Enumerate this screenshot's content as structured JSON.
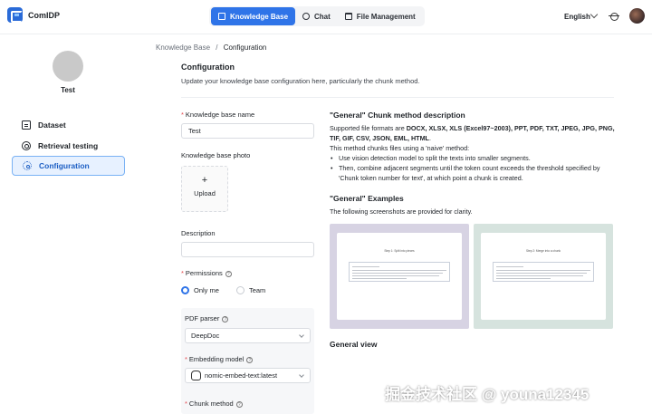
{
  "app": {
    "title": "ComIDP"
  },
  "nav": {
    "tabs": [
      {
        "label": "Knowledge Base",
        "icon": "knowledge-base-icon",
        "active": true
      },
      {
        "label": "Chat",
        "icon": "chat-icon",
        "active": false
      },
      {
        "label": "File Management",
        "icon": "folder-icon",
        "active": false
      }
    ]
  },
  "header": {
    "language": "English"
  },
  "sidebar": {
    "kb_name": "Test",
    "items": [
      {
        "label": "Dataset",
        "icon": "document-icon"
      },
      {
        "label": "Retrieval testing",
        "icon": "target-icon"
      },
      {
        "label": "Configuration",
        "icon": "gear-icon",
        "active": true
      }
    ]
  },
  "breadcrumb": {
    "parent": "Knowledge Base",
    "separator": "/",
    "current": "Configuration"
  },
  "main": {
    "title": "Configuration",
    "description": "Update your knowledge base configuration here, particularly the chunk method."
  },
  "form": {
    "name_label": "Knowledge base name",
    "name_value": "Test",
    "photo_label": "Knowledge base photo",
    "upload_plus": "+",
    "upload_label": "Upload",
    "description_label": "Description",
    "description_value": "",
    "permissions_label": "Permissions",
    "permission_options": [
      "Only me",
      "Team"
    ],
    "pdf_parser_label": "PDF parser",
    "pdf_parser_value": "DeepDoc",
    "embedding_label": "Embedding model",
    "embedding_value": "nomic-embed-text:latest",
    "chunk_method_label": "Chunk method"
  },
  "help_mark": "?",
  "required_mark": "*",
  "info": {
    "chunk_title": "\"General\" Chunk method description",
    "formats_prefix": "Supported file formats are ",
    "formats_list": "DOCX, XLSX, XLS (Excel97~2003), PPT, PDF, TXT, JPEG, JPG, PNG, TIF, GIF, CSV, JSON, EML, HTML",
    "formats_suffix": ".",
    "method_intro": "This method chunks files using a 'naive' method:",
    "bullets": [
      "Use vision detection model to split the texts into smaller segments.",
      "Then, combine adjacent segments until the token count exceeds the threshold specified by 'Chunk token number for text', at which point a chunk is created."
    ],
    "examples_title": "\"General\" Examples",
    "examples_desc": "The following screenshots are provided for clarity.",
    "screenshot_captions": [
      "Step 1: Split into pieces",
      "Step 2: Merge into a chunk"
    ],
    "general_view": "General view"
  },
  "watermark": "掘金技术社区 @ youna12345",
  "colors": {
    "accent": "#2f74e8",
    "required": "#e5484d",
    "active_bg": "#e7f1ff"
  }
}
